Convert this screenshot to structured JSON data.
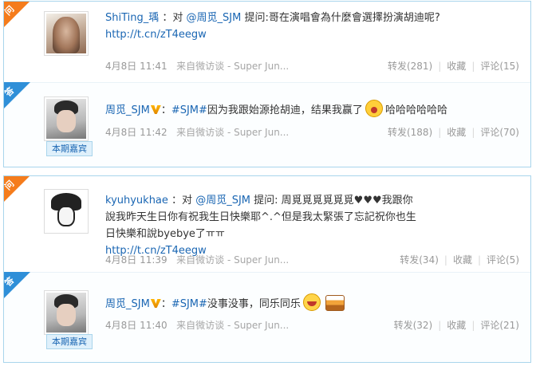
{
  "labels": {
    "ask_glyph": "问",
    "answer_glyph": "答",
    "guest_badge": "本期嘉宾"
  },
  "card1": {
    "question": {
      "user": "ShiTing_瑀",
      "prefix": "：对",
      "mention": "@周觅_SJM",
      "text": "提问:哥在演唱會為什麼會選擇扮演胡迪呢?",
      "link": "http://t.cn/zT4eegw",
      "time": "4月8日 11:41",
      "source": "来自微访谈 - Super Jun...",
      "repost": "转发(281)",
      "collect": "收藏",
      "comment": "评论(15)"
    },
    "answer": {
      "user": "周觅_SJM",
      "colon": "：",
      "topic": "#SJM#",
      "text": "因为我跟始源抢胡迪，结果我赢了",
      "text_after": "哈哈哈哈哈哈",
      "time": "4月8日 11:42",
      "source": "来自微访谈 - Super Jun...",
      "repost": "转发(188)",
      "collect": "收藏",
      "comment": "评论(70)"
    }
  },
  "card2": {
    "question": {
      "user": "kyuhyukhae",
      "prefix": "：对",
      "mention": "@周觅_SJM",
      "text": "提问: 周覓覓覓覓覓覓♥♥♥我跟你說我昨天生日你有祝我生日快樂耶^.^但是我太緊張了忘記祝你也生日快樂和說byebye了ㅠㅠ",
      "link": "http://t.cn/zT4eegw",
      "time": "4月8日 11:39",
      "source": "来自微访谈 - Super Jun...",
      "repost": "转发(34)",
      "collect": "收藏",
      "comment": "评论(5)"
    },
    "answer": {
      "user": "周觅_SJM",
      "colon": "：",
      "topic": "#SJM#",
      "text": "没事没事，同乐同乐",
      "time": "4月8日 11:40",
      "source": "来自微访谈 - Super Jun...",
      "repost": "转发(32)",
      "collect": "收藏",
      "comment": "评论(21)"
    }
  },
  "colors": {
    "link": "#1a66b3",
    "border": "#a9d5ec",
    "ask_corner": "#f57c1c",
    "answer_corner": "#2f8fd8",
    "meta": "#999999"
  }
}
